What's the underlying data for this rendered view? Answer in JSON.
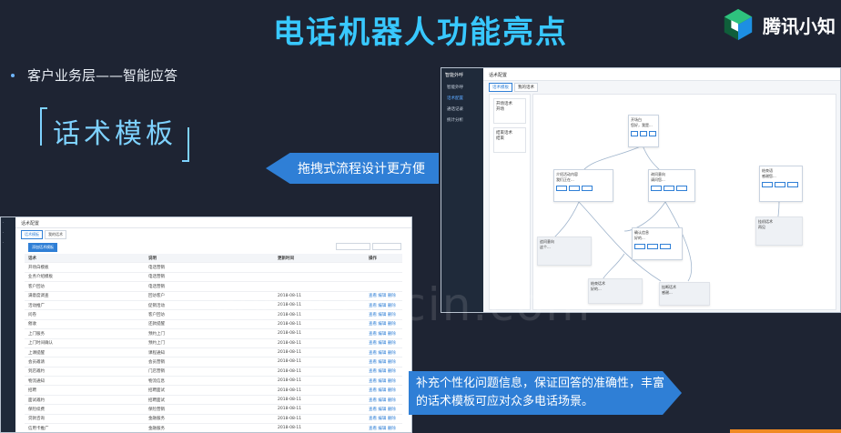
{
  "slide": {
    "title": "电话机器人功能亮点",
    "logo_text": "腾讯小知",
    "bullet": "客户业务层——智能应答",
    "section_title": "话术模板",
    "callout_drag": "拖拽式流程设计更方便",
    "callout_info": "补充个性化问题信息，保证回答的准确性，丰富的话术模板可应对众多电话场景。",
    "watermark": "www.docin.com"
  },
  "flow_editor": {
    "brand": "智能外呼",
    "menu": [
      "智能外呼",
      "话术配置",
      "通话记录",
      "统计分析"
    ],
    "breadcrumb": "话术配置",
    "tabs": [
      "话术模板",
      "我的话术"
    ],
    "left_panel": [
      {
        "title": "开场话术",
        "sub": "开场"
      },
      {
        "title": "结束话术",
        "sub": "结束"
      }
    ],
    "nodes": [
      {
        "title": "开场白",
        "text": "您好，我是..."
      },
      {
        "title": "介绍活动内容",
        "text": "我们正在..."
      },
      {
        "title": "询问意向",
        "text": "请问您..."
      },
      {
        "title": "结束语",
        "text": "感谢您..."
      },
      {
        "title": "追问意向",
        "text": "这个..."
      },
      {
        "title": "确认信息",
        "text": "好的..."
      },
      {
        "title": "挂机话术",
        "text": "再见"
      },
      {
        "title": "结束话术",
        "text": "好的..."
      },
      {
        "title": "挂断话术",
        "text": "感谢..."
      }
    ]
  },
  "template_table": {
    "breadcrumb": "话术配置",
    "tabs": [
      "话术模板",
      "我的话术"
    ],
    "add_button": "添加话术模板",
    "headers": [
      "话术",
      "说明",
      "更新时间",
      "操作"
    ],
    "rows": [
      [
        "开场白模板",
        "电话营销",
        "",
        ""
      ],
      [
        "业务介绍模板",
        "电话营销",
        "",
        ""
      ],
      [
        "客户回访",
        "电话营销",
        "",
        ""
      ],
      [
        "满意度调查",
        "回访客户",
        "2018-08-11",
        "查看 编辑 删除"
      ],
      [
        "活动推广",
        "促销活动",
        "2018-08-11",
        "查看 编辑 删除"
      ],
      [
        "问卷",
        "客户回访",
        "2018-08-11",
        "查看 编辑 删除"
      ],
      [
        "催收",
        "还款提醒",
        "2018-08-11",
        "查看 编辑 删除"
      ],
      [
        "上门服务",
        "预约上门",
        "2018-08-11",
        "查看 编辑 删除"
      ],
      [
        "上门时间确认",
        "预约上门",
        "2018-08-11",
        "查看 编辑 删除"
      ],
      [
        "上课提醒",
        "课程通知",
        "2018-08-11",
        "查看 编辑 删除"
      ],
      [
        "会员邀请",
        "会员营销",
        "2018-08-11",
        "查看 编辑 删除"
      ],
      [
        "到店邀约",
        "门店营销",
        "2018-08-11",
        "查看 编辑 删除"
      ],
      [
        "物流通知",
        "物流信息",
        "2018-08-11",
        "查看 编辑 删除"
      ],
      [
        "招聘",
        "招聘面试",
        "2018-08-11",
        "查看 编辑 删除"
      ],
      [
        "面试邀约",
        "招聘面试",
        "2018-08-11",
        "查看 编辑 删除"
      ],
      [
        "保险续费",
        "保险营销",
        "2018-08-11",
        "查看 编辑 删除"
      ],
      [
        "贷款咨询",
        "金融服务",
        "2018-08-11",
        "查看 编辑 删除"
      ],
      [
        "信用卡推广",
        "金融服务",
        "2018-08-11",
        "查看 编辑 删除"
      ],
      [
        "房产推广",
        "地产营销",
        "2018-08-11",
        "查看 编辑 删除"
      ],
      [
        "汽车保养",
        "售后服务",
        "2018-08-11",
        "查看 编辑 删除"
      ]
    ]
  }
}
